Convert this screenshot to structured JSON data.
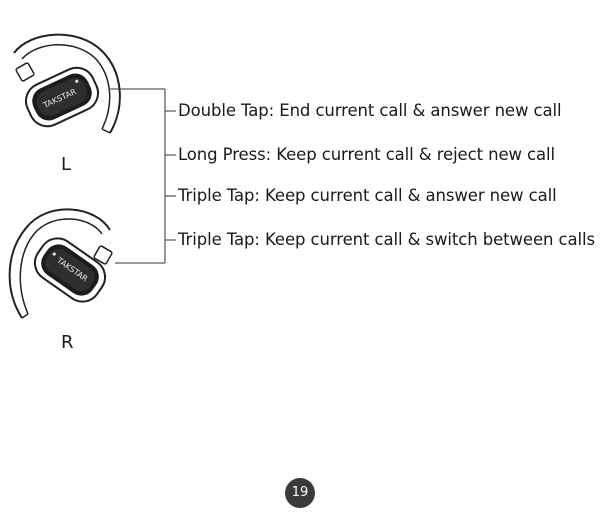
{
  "earbuds": {
    "left": {
      "side_label": "L",
      "brand": "TAKSTAR"
    },
    "right": {
      "side_label": "R",
      "brand": "TAKSTAR"
    }
  },
  "instructions": [
    {
      "text": "Double Tap: End current call & answer new call"
    },
    {
      "text": "Long Press: Keep current call & reject new call"
    },
    {
      "text": "Triple Tap: Keep current call & answer new call"
    },
    {
      "text": "Triple Tap: Keep current call & switch between calls"
    }
  ],
  "page_number": "19"
}
